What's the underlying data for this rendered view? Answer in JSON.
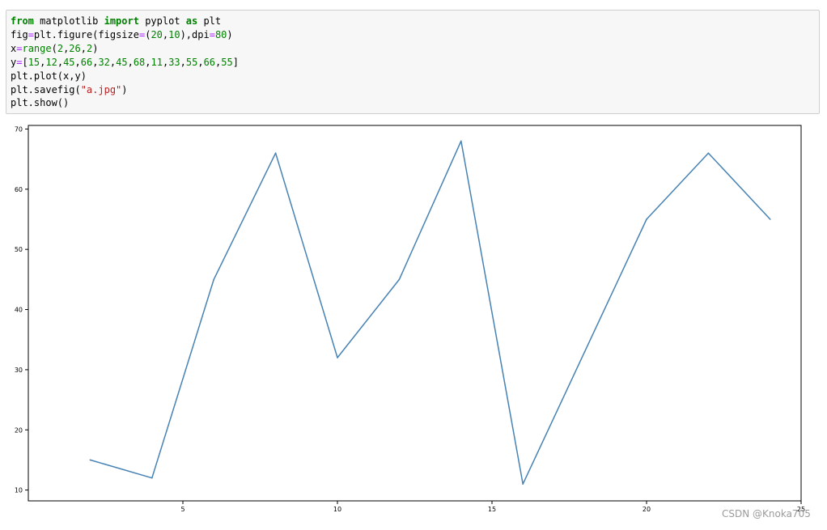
{
  "code_cell": {
    "lines": [
      [
        {
          "t": "kw",
          "v": "from"
        },
        {
          "t": "p",
          "v": " matplotlib "
        },
        {
          "t": "kw",
          "v": "import"
        },
        {
          "t": "p",
          "v": " pyplot "
        },
        {
          "t": "kw",
          "v": "as"
        },
        {
          "t": "p",
          "v": " plt"
        }
      ],
      [
        {
          "t": "p",
          "v": "fig"
        },
        {
          "t": "op",
          "v": "="
        },
        {
          "t": "p",
          "v": "plt.figure(figsize"
        },
        {
          "t": "op",
          "v": "="
        },
        {
          "t": "p",
          "v": "("
        },
        {
          "t": "num",
          "v": "20"
        },
        {
          "t": "p",
          "v": ","
        },
        {
          "t": "num",
          "v": "10"
        },
        {
          "t": "p",
          "v": "),dpi"
        },
        {
          "t": "op",
          "v": "="
        },
        {
          "t": "num",
          "v": "80"
        },
        {
          "t": "p",
          "v": ")"
        }
      ],
      [
        {
          "t": "p",
          "v": "x"
        },
        {
          "t": "op",
          "v": "="
        },
        {
          "t": "bi",
          "v": "range"
        },
        {
          "t": "p",
          "v": "("
        },
        {
          "t": "num",
          "v": "2"
        },
        {
          "t": "p",
          "v": ","
        },
        {
          "t": "num",
          "v": "26"
        },
        {
          "t": "p",
          "v": ","
        },
        {
          "t": "num",
          "v": "2"
        },
        {
          "t": "p",
          "v": ")"
        }
      ],
      [
        {
          "t": "p",
          "v": "y"
        },
        {
          "t": "op",
          "v": "="
        },
        {
          "t": "p",
          "v": "["
        },
        {
          "t": "num",
          "v": "15"
        },
        {
          "t": "p",
          "v": ","
        },
        {
          "t": "num",
          "v": "12"
        },
        {
          "t": "p",
          "v": ","
        },
        {
          "t": "num",
          "v": "45"
        },
        {
          "t": "p",
          "v": ","
        },
        {
          "t": "num",
          "v": "66"
        },
        {
          "t": "p",
          "v": ","
        },
        {
          "t": "num",
          "v": "32"
        },
        {
          "t": "p",
          "v": ","
        },
        {
          "t": "num",
          "v": "45"
        },
        {
          "t": "p",
          "v": ","
        },
        {
          "t": "num",
          "v": "68"
        },
        {
          "t": "p",
          "v": ","
        },
        {
          "t": "num",
          "v": "11"
        },
        {
          "t": "p",
          "v": ","
        },
        {
          "t": "num",
          "v": "33"
        },
        {
          "t": "p",
          "v": ","
        },
        {
          "t": "num",
          "v": "55"
        },
        {
          "t": "p",
          "v": ","
        },
        {
          "t": "num",
          "v": "66"
        },
        {
          "t": "p",
          "v": ","
        },
        {
          "t": "num",
          "v": "55"
        },
        {
          "t": "p",
          "v": "]"
        }
      ],
      [
        {
          "t": "p",
          "v": "plt.plot(x,y)"
        }
      ],
      [
        {
          "t": "p",
          "v": "plt.savefig("
        },
        {
          "t": "str",
          "v": "\"a.jpg\""
        },
        {
          "t": "p",
          "v": ")"
        }
      ],
      [
        {
          "t": "p",
          "v": "plt.show()"
        }
      ]
    ]
  },
  "chart_data": {
    "type": "line",
    "x": [
      2,
      4,
      6,
      8,
      10,
      12,
      14,
      16,
      18,
      20,
      22,
      24
    ],
    "series": [
      {
        "values": [
          15,
          12,
          45,
          66,
          32,
          45,
          68,
          11,
          33,
          55,
          66,
          55
        ],
        "color": "#4682b4"
      }
    ],
    "xlim": [
      0,
      25
    ],
    "ylim": [
      8.2,
      70.6
    ],
    "xticks": [
      5,
      10,
      15,
      20,
      25
    ],
    "yticks": [
      10,
      20,
      30,
      40,
      50,
      60,
      70
    ],
    "title": "",
    "xlabel": "",
    "ylabel": "",
    "grid": false
  },
  "watermark": "CSDN @Knoka705"
}
